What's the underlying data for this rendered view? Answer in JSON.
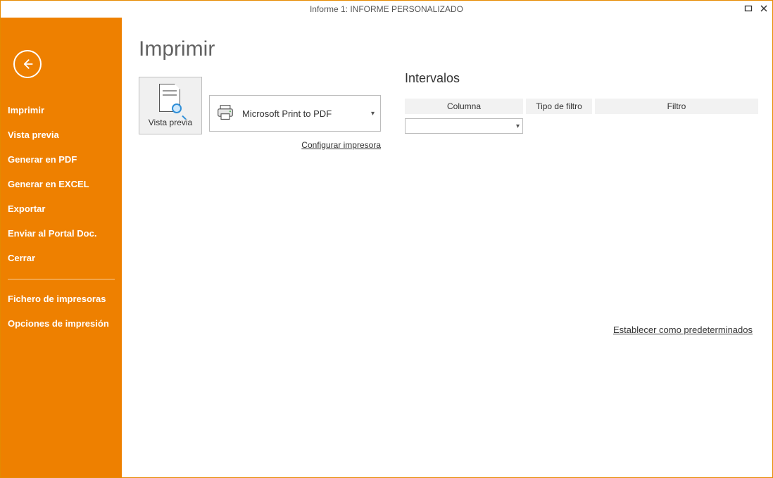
{
  "window": {
    "title": "Informe 1: INFORME PERSONALIZADO"
  },
  "sidebar": {
    "items": [
      {
        "label": "Imprimir"
      },
      {
        "label": "Vista previa"
      },
      {
        "label": "Generar en PDF"
      },
      {
        "label": "Generar en EXCEL"
      },
      {
        "label": "Exportar"
      },
      {
        "label": "Enviar al Portal Doc."
      },
      {
        "label": "Cerrar"
      }
    ],
    "secondary": [
      {
        "label": "Fichero de impresoras"
      },
      {
        "label": "Opciones de impresión"
      }
    ]
  },
  "page": {
    "title": "Imprimir",
    "preview_button": "Vista previa",
    "printer": {
      "name": "Microsoft Print to PDF"
    },
    "configure_printer": "Configurar impresora",
    "intervals": {
      "title": "Intervalos",
      "headers": {
        "columna": "Columna",
        "tipo": "Tipo de filtro",
        "filtro": "Filtro"
      },
      "rows": [
        {
          "columna": "",
          "tipo": "",
          "filtro": ""
        }
      ]
    },
    "set_defaults": "Establecer como predeterminados"
  }
}
